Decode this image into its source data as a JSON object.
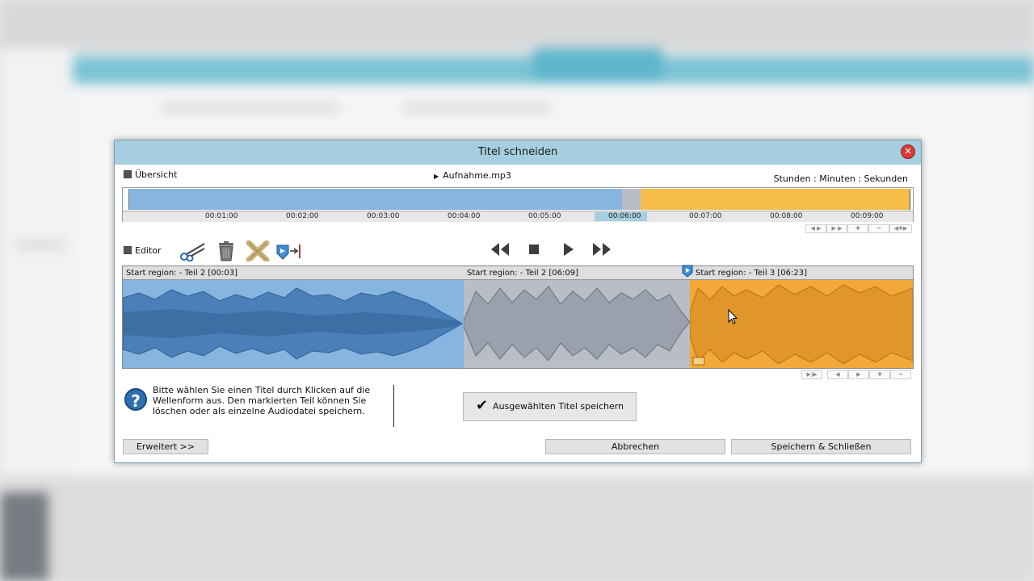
{
  "dialog": {
    "title": "Titel schneiden",
    "close_icon": "close-icon"
  },
  "overview": {
    "label": "Übersicht",
    "file_name": "Aufnahme.mp3",
    "time_format": "Stunden : Minuten : Sekunden",
    "ticks": [
      "00:01:00",
      "00:02:00",
      "00:03:00",
      "00:04:00",
      "00:05:00",
      "00:06:00",
      "00:07:00",
      "00:08:00",
      "00:09:00"
    ],
    "highlighted_tick": "00:06:00"
  },
  "editor": {
    "label": "Editor",
    "tools": [
      "scissors-icon",
      "trash-icon",
      "cross-out-icon",
      "marker-jump-icon"
    ],
    "transport": [
      "rewind-icon",
      "stop-icon",
      "play-icon",
      "fast-forward-icon"
    ],
    "regions": [
      {
        "label": "Start region: - Teil  2 [00:03]",
        "color": "#86b5e0"
      },
      {
        "label": "Start region: - Teil  2 [06:09]",
        "color": "#b8bdc8"
      },
      {
        "label": "Start region: - Teil  3 [06:23]",
        "color": "#f3a83a"
      }
    ]
  },
  "help": {
    "text": "Bitte wählen Sie einen Titel durch Klicken auf die Wellenform aus. Den markierten Teil können Sie löschen oder als einzelne Audiodatei speichern."
  },
  "buttons": {
    "save_selected": "Ausgewählten Titel speichern",
    "advanced": "Erweitert >>",
    "cancel": "Abbrechen",
    "save_close": "Speichern & Schließen"
  },
  "colors": {
    "titlebar": "#a5cfe0",
    "blue_region": "#86b5e0",
    "gray_region": "#b8bdc8",
    "orange_region": "#f3a83a",
    "overview_orange": "#f6bd48"
  }
}
